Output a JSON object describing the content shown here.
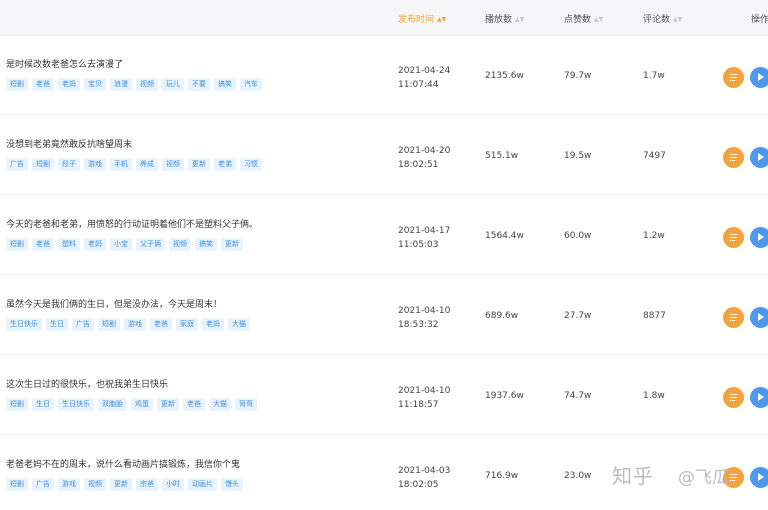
{
  "header": {
    "publish_time": "发布时间",
    "plays": "播放数",
    "likes": "点赞数",
    "comments": "评论数",
    "actions": "操作"
  },
  "rows": [
    {
      "title": "是时候改数老爸怎么去演漫了",
      "tags": [
        "短剧",
        "老爸",
        "老妈",
        "宝贝",
        "浪漫",
        "视频",
        "玩儿",
        "不要",
        "搞笑",
        "汽车"
      ],
      "date": "2021-04-24",
      "time": "11:07:44",
      "plays": "2135.6w",
      "likes": "79.7w",
      "comments": "1.7w"
    },
    {
      "title": "没想到老弟竟然敢反抗啥望周末",
      "tags": [
        "广告",
        "短剧",
        "段子",
        "游戏",
        "手机",
        "养成",
        "视频",
        "更新",
        "老弟",
        "习惯"
      ],
      "date": "2021-04-20",
      "time": "18:02:51",
      "plays": "515.1w",
      "likes": "19.5w",
      "comments": "7497"
    },
    {
      "title": "今天的老爸和老弟，用愤怒的行动证明着他们不是塑料父子俩。",
      "tags": [
        "短剧",
        "老爸",
        "塑料",
        "老妈",
        "小宝",
        "父子俩",
        "视频",
        "搞笑",
        "更新"
      ],
      "date": "2021-04-17",
      "time": "11:05:03",
      "plays": "1564.4w",
      "likes": "60.0w",
      "comments": "1.2w"
    },
    {
      "title": "虽然今天是我们俩的生日，但是没办法，今天是周末！",
      "tags": [
        "生日快乐",
        "生日",
        "广告",
        "短剧",
        "游戏",
        "老爸",
        "家庭",
        "老妈",
        "大猫"
      ],
      "date": "2021-04-10",
      "time": "18:53:32",
      "plays": "689.6w",
      "likes": "27.7w",
      "comments": "8877"
    },
    {
      "title": "这次生日过的很快乐，也祝我弟生日快乐",
      "tags": [
        "短剧",
        "生日",
        "生日快乐",
        "双胞胎",
        "鸡蛋",
        "更新",
        "老爸",
        "大猫",
        "哥哥"
      ],
      "date": "2021-04-10",
      "time": "11:18:57",
      "plays": "1937.6w",
      "likes": "74.7w",
      "comments": "1.8w"
    },
    {
      "title": "老爸老妈不在的周末，说什么看动画片搞锻炼，我信你个鬼",
      "tags": [
        "短剧",
        "广告",
        "游戏",
        "视频",
        "更新",
        "宗爸",
        "小时",
        "动画片",
        "馒头"
      ],
      "date": "2021-04-03",
      "time": "18:02:05",
      "plays": "716.9w",
      "likes": "23.0w",
      "comments": ""
    }
  ],
  "watermark": {
    "site": "知乎",
    "handle": "@飞瓜"
  },
  "colors": {
    "accent": "#f2a33a",
    "tag_bg": "#e8f3fd",
    "tag_text": "#3d8fdd",
    "blue_button": "#4c98f0",
    "orange_button": "#f3a23d"
  },
  "icons": {
    "detail": "list-icon",
    "play": "play-icon",
    "sort": "sort-icon"
  }
}
